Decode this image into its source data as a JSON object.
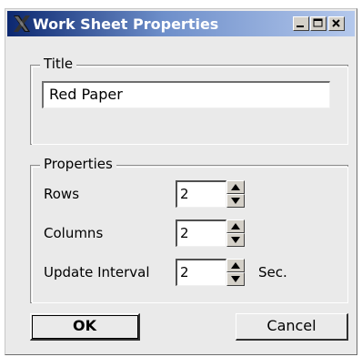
{
  "window": {
    "title": "Work Sheet Properties",
    "controls": {
      "minimize": "minimize",
      "maximize": "maximize",
      "close": "close"
    }
  },
  "title_group": {
    "legend": "Title",
    "value": "Red Paper"
  },
  "properties_group": {
    "legend": "Properties",
    "rows": {
      "label": "Rows",
      "value": "2"
    },
    "columns": {
      "label": "Columns",
      "value": "2"
    },
    "update_interval": {
      "label": "Update Interval",
      "value": "2",
      "unit": "Sec."
    }
  },
  "buttons": {
    "ok": "OK",
    "cancel": "Cancel"
  },
  "icons": {
    "app": "x-app-icon",
    "spin_up": "arrow-up-icon",
    "spin_down": "arrow-down-icon"
  },
  "colors": {
    "titlebar_start": "#0c2870",
    "titlebar_end": "#b4c8ec",
    "dialog_bg": "#eaeaea"
  }
}
